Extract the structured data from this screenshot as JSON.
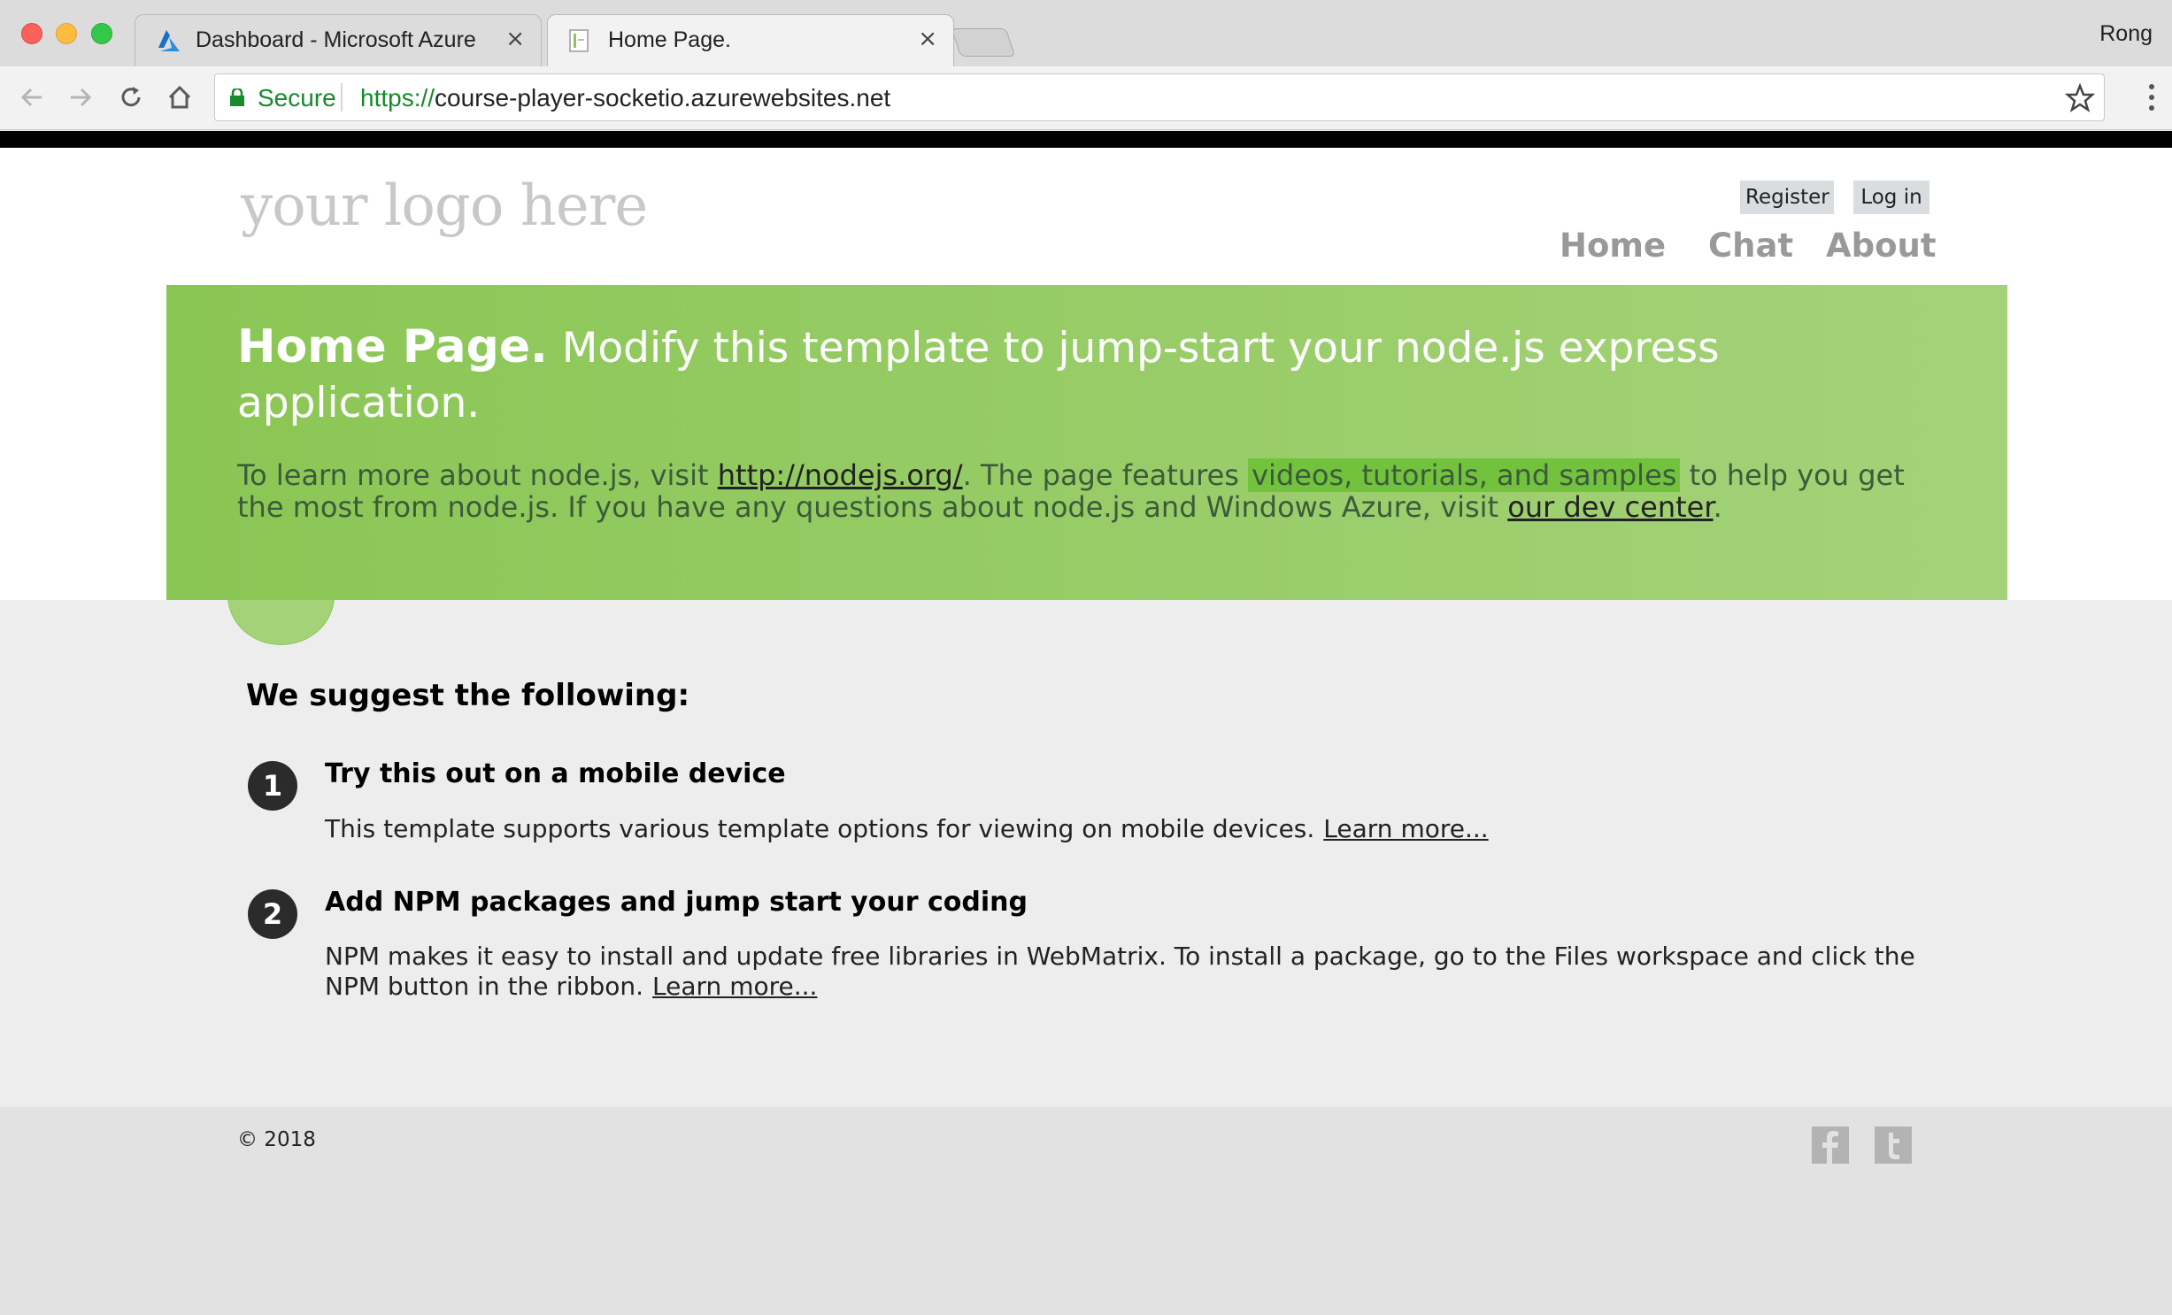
{
  "browser": {
    "tabs": [
      {
        "title": "Dashboard - Microsoft Azure",
        "active": false,
        "favicon": "azure-icon"
      },
      {
        "title": "Home Page.",
        "active": true,
        "favicon": "page-icon"
      }
    ],
    "profile_name": "Rong",
    "address": {
      "secure_label": "Secure",
      "url_scheme": "https://",
      "url_host": "course-player-socketio.azurewebsites.net"
    }
  },
  "header": {
    "logo_text": "your logo here",
    "auth": {
      "register": "Register",
      "login": "Log in"
    },
    "nav": [
      "Home",
      "Chat",
      "About"
    ]
  },
  "hero": {
    "title": "Home Page.",
    "subtitle": "Modify this template to jump-start your node.js express application.",
    "body_1": "To learn more about node.js, visit ",
    "link_nodejs": "http://nodejs.org/",
    "body_2": ". The page features ",
    "highlight": "videos, tutorials, and samples",
    "body_3": " to help you get the most from node.js. If you have any questions about node.js and Windows Azure, visit ",
    "link_devcenter": "our dev center",
    "body_4": "."
  },
  "suggestions": {
    "heading": "We suggest the following:",
    "items": [
      {
        "number": "1",
        "title": "Try this out on a mobile device",
        "text": "This template supports various template options for viewing on mobile devices.",
        "link": "Learn more..."
      },
      {
        "number": "2",
        "title": "Add NPM packages and jump start your coding",
        "text": "NPM makes it easy to install and update free libraries in WebMatrix. To install a package, go to the Files workspace and click the NPM button in the ribbon.",
        "link": "Learn more..."
      }
    ]
  },
  "footer": {
    "copyright": "© 2018",
    "social": [
      "facebook-icon",
      "twitter-icon"
    ]
  },
  "colors": {
    "hero_start": "#8ac654",
    "hero_end": "#a4d279",
    "secure_green": "#178a2c"
  }
}
